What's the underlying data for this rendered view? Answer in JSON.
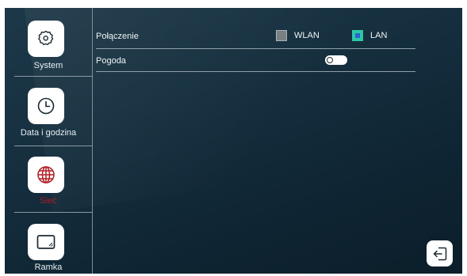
{
  "sidebar": {
    "items": [
      {
        "label": "System",
        "icon": "gear-icon"
      },
      {
        "label": "Data i godzina",
        "icon": "clock-icon"
      },
      {
        "label": "Sieć",
        "icon": "globe-icon",
        "active": true,
        "active_color": "#b11c24"
      },
      {
        "label": "Ramka",
        "icon": "frame-icon"
      }
    ]
  },
  "settings": {
    "connection": {
      "label": "Połączenie",
      "options": [
        {
          "label": "WLAN",
          "checked": false
        },
        {
          "label": "LAN",
          "checked": true
        }
      ]
    },
    "weather": {
      "label": "Pogoda",
      "enabled": false
    }
  },
  "actions": {
    "exit_icon": "exit-icon"
  },
  "colors": {
    "accent": "#2dc7a3",
    "active_label": "#b11c24",
    "background": "#163040"
  }
}
